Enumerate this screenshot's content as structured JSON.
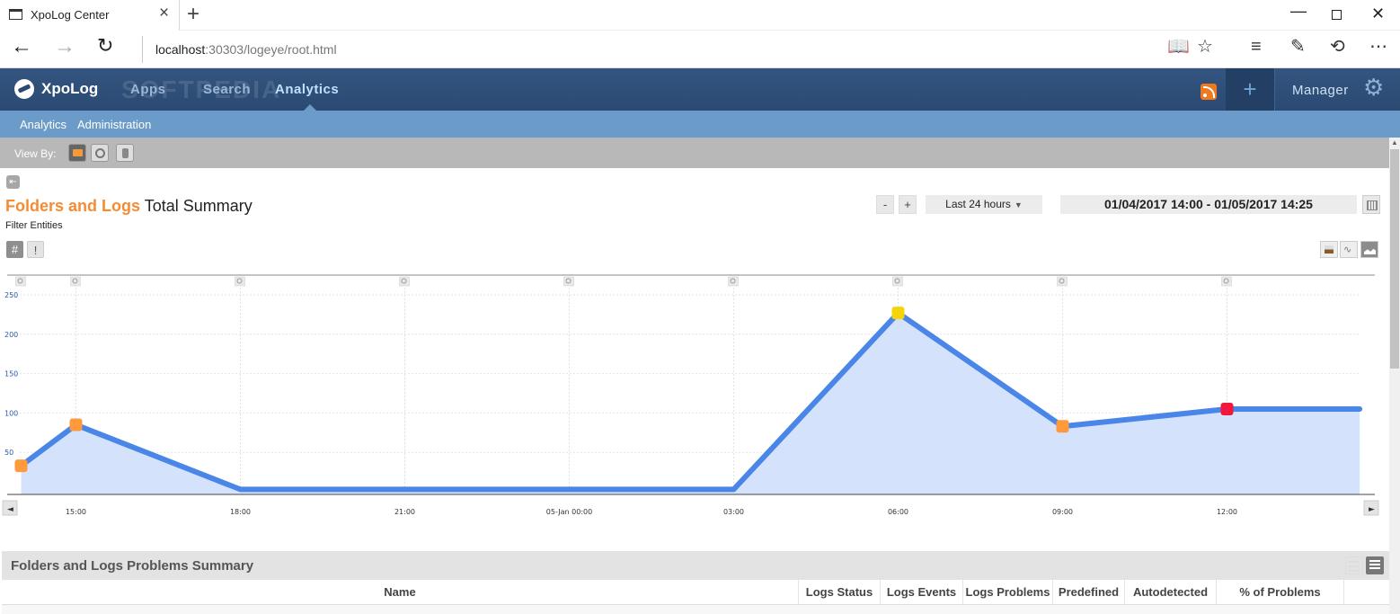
{
  "browser": {
    "tab_title": "XpoLog Center",
    "new_tab_symbol": "+",
    "url_host": "localhost",
    "url_rest": ":30303/logeye/root.html"
  },
  "app": {
    "logo": "XpoLog",
    "nav": {
      "apps": "Apps",
      "search": "Search",
      "analytics": "Analytics"
    },
    "watermark": "SOFTPEDIA",
    "add_symbol": "+",
    "manager": "Manager",
    "subnav": {
      "analytics": "Analytics",
      "administration": "Administration"
    }
  },
  "viewby": {
    "label": "View By:"
  },
  "summary": {
    "title_orange": "Folders and Logs",
    "title_rest": "Total Summary",
    "filter_label": "Filter Entities",
    "hash": "#",
    "bang": "!",
    "minus": "-",
    "plus": "+",
    "range": "Last 24 hours",
    "date_range": "01/04/2017 14:00 - 01/05/2017 14:25"
  },
  "chart_data": {
    "type": "area",
    "x": [
      "14:00",
      "15:00",
      "18:00",
      "21:00",
      "05-Jan 00:00",
      "03:00",
      "06:00",
      "09:00",
      "12:00",
      "14:25"
    ],
    "x_hours": [
      14,
      15,
      18,
      21,
      24,
      27,
      30,
      33,
      36,
      38.42
    ],
    "series": [
      {
        "values": [
          33,
          85,
          3,
          3,
          3,
          3,
          227,
          83,
          105,
          105
        ]
      }
    ],
    "point_colors": [
      "#ff9a3c",
      "#ff9a3c",
      null,
      null,
      null,
      null,
      "#f5d40a",
      "#ff9a3c",
      "#f2183c",
      null
    ],
    "xtick_labels": [
      "15:00",
      "18:00",
      "21:00",
      "05-Jan 00:00",
      "03:00",
      "06:00",
      "09:00",
      "12:00"
    ],
    "xtick_hours": [
      15,
      18,
      21,
      24,
      27,
      30,
      33,
      36
    ],
    "ytick_labels": [
      "50",
      "100",
      "150",
      "200",
      "250"
    ],
    "ylim": [
      0,
      250
    ],
    "xlim": [
      14,
      38.8
    ],
    "line_color": "#4a86e8",
    "fill_color": "#cfe0fb",
    "grid": true
  },
  "problems": {
    "title": "Folders and Logs Problems Summary",
    "columns": [
      "Name",
      "Logs Status",
      "Logs Events",
      "Logs Problems",
      "Predefined",
      "Autodetected",
      "% of Problems"
    ]
  }
}
